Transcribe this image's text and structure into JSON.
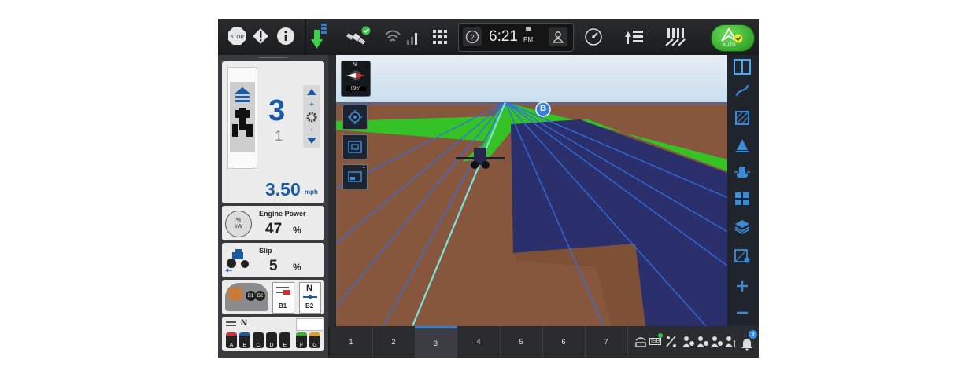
{
  "topbar": {
    "stop_label": "STOP",
    "time": "6:21",
    "ampm": "PM",
    "auto_label": "AUTO"
  },
  "left": {
    "gear_current": "3",
    "gear_next": "1",
    "speed": "3.50",
    "speed_unit": "mph",
    "engine_power_title": "Engine Power",
    "engine_power_value": "47",
    "engine_power_unit": "%",
    "engine_icon_text": "% kW",
    "slip_title": "Slip",
    "slip_value": "5",
    "slip_unit": "%",
    "hitch": {
      "b1": "B1",
      "b2": "B2",
      "n": "N"
    },
    "remotes": {
      "n": "N",
      "letters": [
        "A",
        "B",
        "C",
        "D",
        "E",
        "F",
        "G"
      ]
    }
  },
  "view": {
    "compass_n": "N",
    "heading": "095°",
    "line_marker": "B",
    "layout_badge": "1"
  },
  "bottom": {
    "tabs": [
      "1",
      "2",
      "3",
      "4",
      "5",
      "6",
      "7"
    ],
    "active_tab": "3",
    "isb_label": "ISB",
    "notify_count": "9"
  },
  "colors": {
    "accent": "#1a5aa5",
    "auto": "#35b233",
    "soil": "#8a5a3e",
    "coverage": "#2c2f6a",
    "headland": "#35c424"
  }
}
